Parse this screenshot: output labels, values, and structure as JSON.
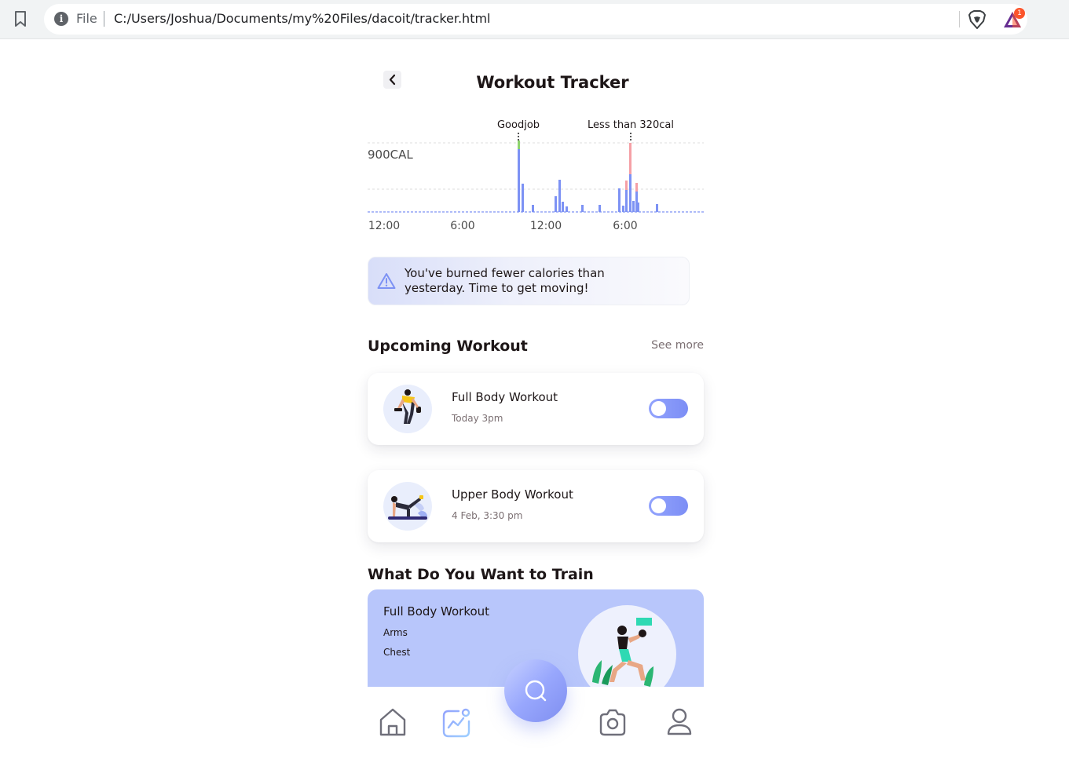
{
  "browser": {
    "scheme": "File",
    "url": "C:/Users/Joshua/Documents/my%20Files/dacoit/tracker.html",
    "rewards_badge": "1"
  },
  "header": {
    "title": "Workout Tracker"
  },
  "chart_data": {
    "type": "bar",
    "annotations": [
      "Goodjob",
      "Less than 320cal"
    ],
    "ytick_label": "900CAL",
    "xtick_labels": [
      "12:00",
      "6:00",
      "12:00",
      "6:00"
    ],
    "colors": {
      "base": "#7d92f4",
      "good": "#8fd46f",
      "low": "#f5a0a6"
    }
  },
  "alert": {
    "text": "You've burned fewer calories than yesterday. Time to get moving!",
    "icon": "warning-triangle-icon"
  },
  "upcoming": {
    "title": "Upcoming Workout",
    "see_more": "See more",
    "items": [
      {
        "name": "Full Body Workout",
        "time": "Today 3pm",
        "enabled": false
      },
      {
        "name": "Upper Body Workout",
        "time": "4 Feb, 3:30 pm",
        "enabled": false
      }
    ]
  },
  "train": {
    "title": "What Do You Want to Train",
    "card": {
      "name": "Full Body Workout",
      "items": [
        "Arms",
        "Chest"
      ]
    }
  },
  "nav": {
    "items": [
      "home-icon",
      "activity-icon",
      "search-icon",
      "camera-icon",
      "profile-icon"
    ],
    "active": "activity-icon"
  }
}
